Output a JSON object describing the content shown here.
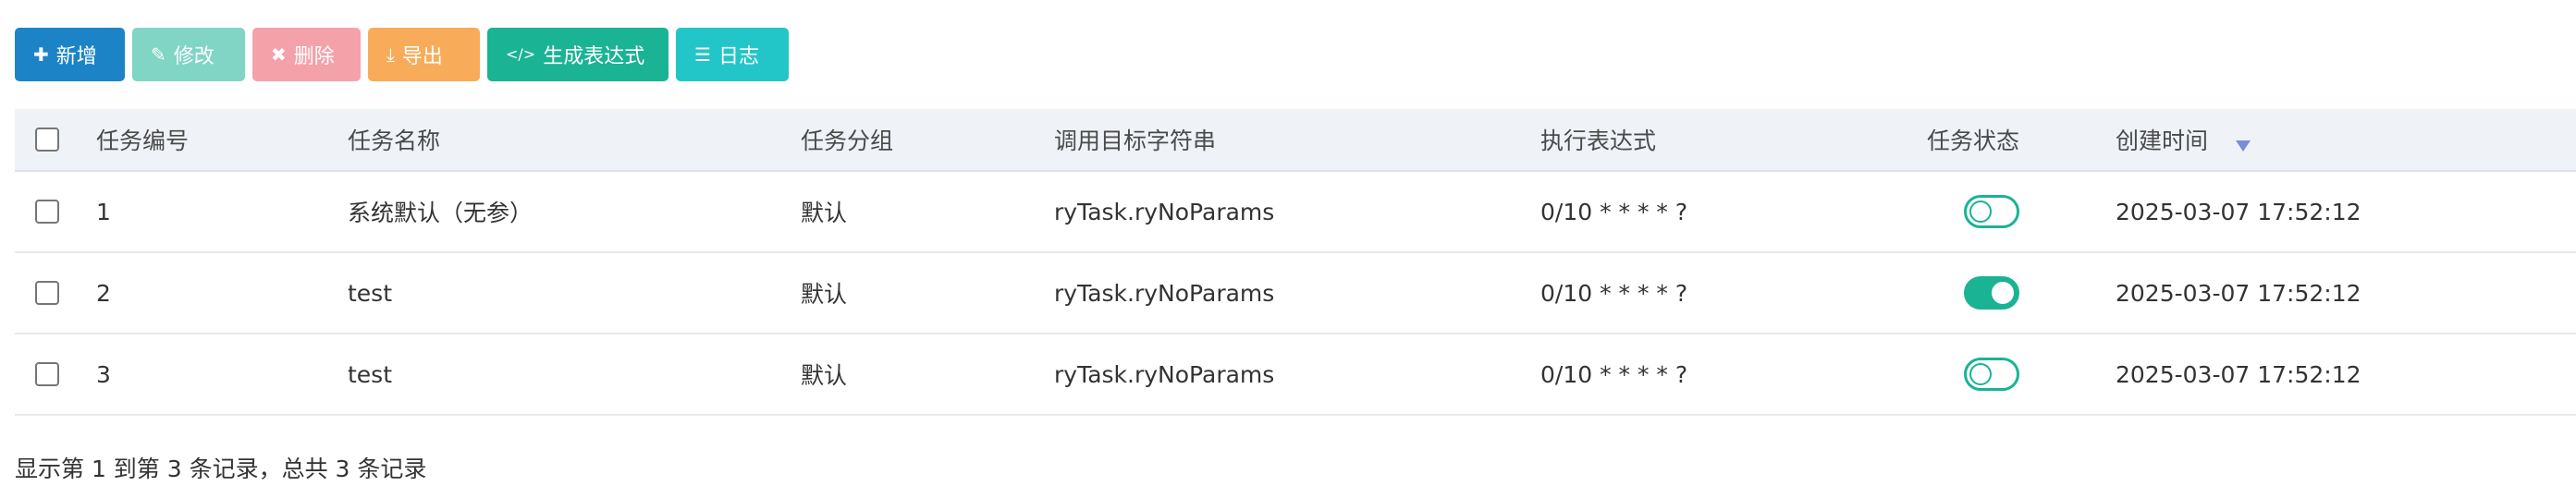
{
  "toolbar": {
    "add": {
      "icon": "plus-icon",
      "label": "新增"
    },
    "edit": {
      "icon": "edit-icon",
      "label": "修改"
    },
    "delete": {
      "icon": "close-icon",
      "label": "删除"
    },
    "export": {
      "icon": "download-icon",
      "label": "导出"
    },
    "expression": {
      "icon": "code-icon",
      "label": "生成表达式"
    },
    "log": {
      "icon": "list-icon",
      "label": "日志"
    }
  },
  "table": {
    "headers": [
      "任务编号",
      "任务名称",
      "任务分组",
      "调用目标字符串",
      "执行表达式",
      "任务状态",
      "创建时间"
    ],
    "sort_icon": "sort-desc-icon",
    "rows": [
      {
        "id": "1",
        "name": "系统默认（无参）",
        "group": "默认",
        "target": "ryTask.ryNoParams",
        "cron": "0/10 * * * * ?",
        "status_on": false,
        "created": "2025-03-07 17:52:12"
      },
      {
        "id": "2",
        "name": "test",
        "group": "默认",
        "target": "ryTask.ryNoParams",
        "cron": "0/10 * * * * ?",
        "status_on": true,
        "created": "2025-03-07 17:52:12"
      },
      {
        "id": "3",
        "name": "test",
        "group": "默认",
        "target": "ryTask.ryNoParams",
        "cron": "0/10 * * * * ?",
        "status_on": false,
        "created": "2025-03-07 17:52:12"
      }
    ]
  },
  "footer": {
    "summary": "显示第 1 到第 3 条记录，总共 3 条记录"
  },
  "colors": {
    "primary": "#1c84c6",
    "success": "#1ab394",
    "danger": "#ed5565",
    "warning": "#f8ac59",
    "info": "#23c6c8"
  }
}
